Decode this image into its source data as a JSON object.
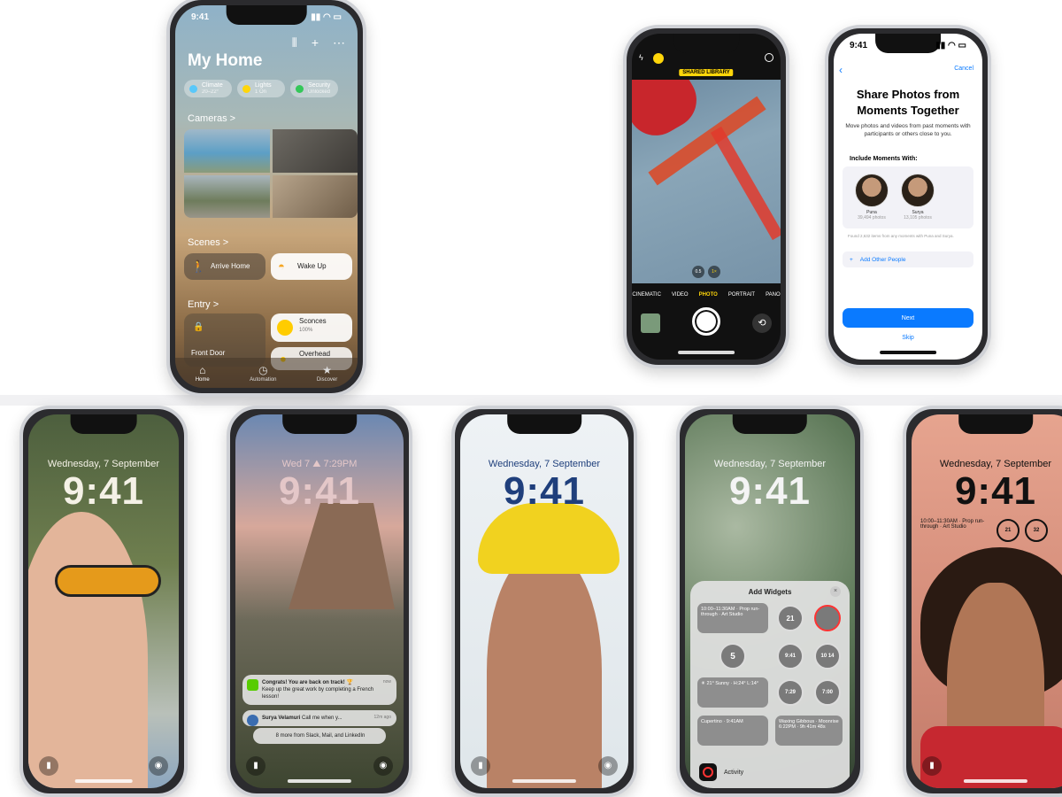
{
  "status": {
    "time": "9:41"
  },
  "home_app": {
    "title": "My Home",
    "header_icons": [
      "voice-icon",
      "plus-icon",
      "more-icon"
    ],
    "chips": [
      {
        "label": "Climate",
        "value": "20–22°"
      },
      {
        "label": "Lights",
        "value": "1 On"
      },
      {
        "label": "Security",
        "value": "Unlocked"
      }
    ],
    "sections": {
      "cameras": "Cameras >",
      "scenes": "Scenes >",
      "entry": "Entry >"
    },
    "scenes": [
      {
        "label": "Arrive Home"
      },
      {
        "label": "Wake Up"
      }
    ],
    "entry": [
      {
        "label": "Front Door",
        "value": ""
      },
      {
        "label": "Sconces",
        "value": "100%"
      },
      {
        "label": "Overhead",
        "value": ""
      }
    ],
    "tabs": [
      "Home",
      "Automation",
      "Discover"
    ]
  },
  "camera_app": {
    "shared_label": "SHARED LIBRARY",
    "zoom": [
      "0.5",
      "1×"
    ],
    "modes": [
      "CINEMATIC",
      "VIDEO",
      "PHOTO",
      "PORTRAIT",
      "PANO"
    ],
    "active_mode": "PHOTO"
  },
  "share_sheet": {
    "cancel": "Cancel",
    "title": "Share Photos from Moments Together",
    "description": "Move photos and videos from past moments with participants or others close to you.",
    "include_label": "Include Moments With:",
    "people": [
      {
        "name": "Puna",
        "sub": "39,494 photos"
      },
      {
        "name": "Surya",
        "sub": "13,105 photos"
      }
    ],
    "note": "Found 2,632 items from any moments with Puna and Surya.",
    "add_other": "Add Other People",
    "next": "Next",
    "skip": "Skip"
  },
  "lock_screens": [
    {
      "date": "Wednesday, 7 September",
      "time": "9:41",
      "color": "#f4f1e6"
    },
    {
      "date": "Wed 7   ⛰ 7:29PM",
      "time": "9:41",
      "color": "#e4c7c8",
      "notifications": [
        {
          "title": "Congrats! You are back on track! 🏆",
          "body": "Keep up the great work by completing a French lesson!",
          "time": "now"
        },
        {
          "title": "Surya Velamuri",
          "body": "Call me when y...",
          "time": "12m ago"
        },
        {
          "title": "",
          "body": "8 more from Slack, Mail, and LinkedIn",
          "time": ""
        }
      ]
    },
    {
      "date": "Wednesday, 7 September",
      "time": "9:41",
      "color": "#1f3f7c"
    },
    {
      "date": "Wednesday, 7 September",
      "time": "9:41",
      "color": "#f4f4f4",
      "panel": {
        "title": "Add Widgets",
        "widgets": [
          [
            "10:00–11:30AM · Prop run-through · Art Studio",
            "21",
            ""
          ],
          [
            "5",
            "",
            "10"
          ],
          [
            "☀ 21° Sunny · H:24° L:14°",
            "7:29",
            "7:00"
          ],
          [
            "Cupertino · 9:41AM",
            "Waxing Gibbous · Moonrise 6:22PM · 9h 41m 48s",
            ""
          ]
        ],
        "widget_small": {
          "r2c2": "9:41",
          "r2c3": "10 14"
        },
        "activity": "Activity"
      }
    },
    {
      "date": "Wednesday, 7 September",
      "time": "9:41",
      "color": "#111111",
      "widgets": [
        "10:00–11:30AM · Prop run-through · Art Studio",
        "21",
        "32"
      ]
    }
  ]
}
